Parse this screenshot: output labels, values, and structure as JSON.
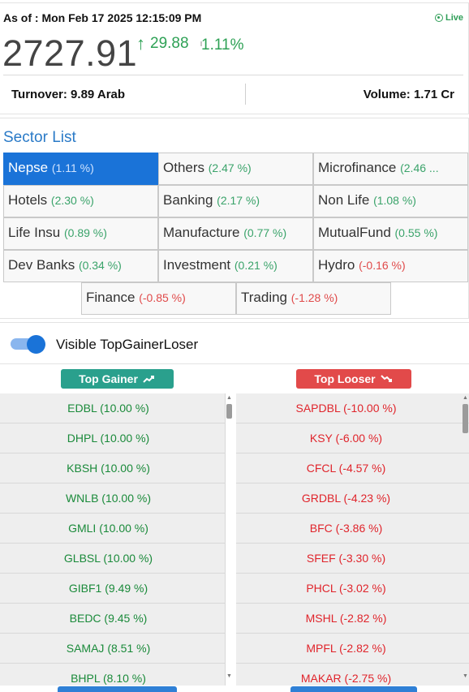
{
  "header": {
    "as_of": "As of : Mon Feb 17 2025 12:15:09 PM",
    "live_label": "Live",
    "index_value": "2727.91",
    "change_arrow": "↑",
    "change_points": "29.88",
    "change_percent": "1.11%",
    "turnover": "Turnover: 9.89 Arab",
    "volume": "Volume: 1.71 Cr"
  },
  "sectors": {
    "title": "Sector List",
    "items": [
      {
        "name": "Nepse",
        "change": "(1.11 %)",
        "dir": "pos",
        "active": true
      },
      {
        "name": "Others",
        "change": "(2.47 %)",
        "dir": "pos"
      },
      {
        "name": "Microfinance",
        "change": "(2.46 ...",
        "dir": "pos"
      },
      {
        "name": "Hotels",
        "change": "(2.30 %)",
        "dir": "pos"
      },
      {
        "name": "Banking",
        "change": "(2.17 %)",
        "dir": "pos"
      },
      {
        "name": "Non Life",
        "change": "(1.08 %)",
        "dir": "pos"
      },
      {
        "name": "Life Insu",
        "change": "(0.89 %)",
        "dir": "pos"
      },
      {
        "name": "Manufacture",
        "change": "(0.77 %)",
        "dir": "pos"
      },
      {
        "name": "MutualFund",
        "change": "(0.55 %)",
        "dir": "pos"
      },
      {
        "name": "Dev Banks",
        "change": "(0.34 %)",
        "dir": "pos"
      },
      {
        "name": "Investment",
        "change": "(0.21 %)",
        "dir": "pos"
      },
      {
        "name": "Hydro",
        "change": "(-0.16 %)",
        "dir": "neg"
      },
      {
        "name": "Finance",
        "change": "(-0.85 %)",
        "dir": "neg"
      },
      {
        "name": "Trading",
        "change": "(-1.28 %)",
        "dir": "neg"
      }
    ]
  },
  "toggle": {
    "label": "Visible TopGainerLoser",
    "enabled": true
  },
  "top_gainer": {
    "button_label": "Top Gainer",
    "icon": "trending-up-icon",
    "rows": [
      "EDBL (10.00 %)",
      "DHPL (10.00 %)",
      "KBSH (10.00 %)",
      "WNLB (10.00 %)",
      "GMLI (10.00 %)",
      "GLBSL (10.00 %)",
      "GIBF1 (9.49 %)",
      "BEDC (9.45 %)",
      "SAMAJ (8.51 %)",
      "BHPL (8.10 %)"
    ]
  },
  "top_looser": {
    "button_label": "Top Looser",
    "icon": "trending-down-icon",
    "rows": [
      "SAPDBL (-10.00 %)",
      "KSY (-6.00 %)",
      "CFCL (-4.57 %)",
      "GRDBL (-4.23 %)",
      "BFC (-3.86 %)",
      "SFEF (-3.30 %)",
      "PHCL (-3.02 %)",
      "MSHL (-2.82 %)",
      "MPFL (-2.82 %)",
      "MAKAR (-2.75 %)"
    ]
  },
  "colors": {
    "accent": "#1a73d8",
    "positive": "#2ea155",
    "negative": "#e0242b",
    "gainer_button": "#2aa08d",
    "looser_button": "#e24a4a"
  }
}
